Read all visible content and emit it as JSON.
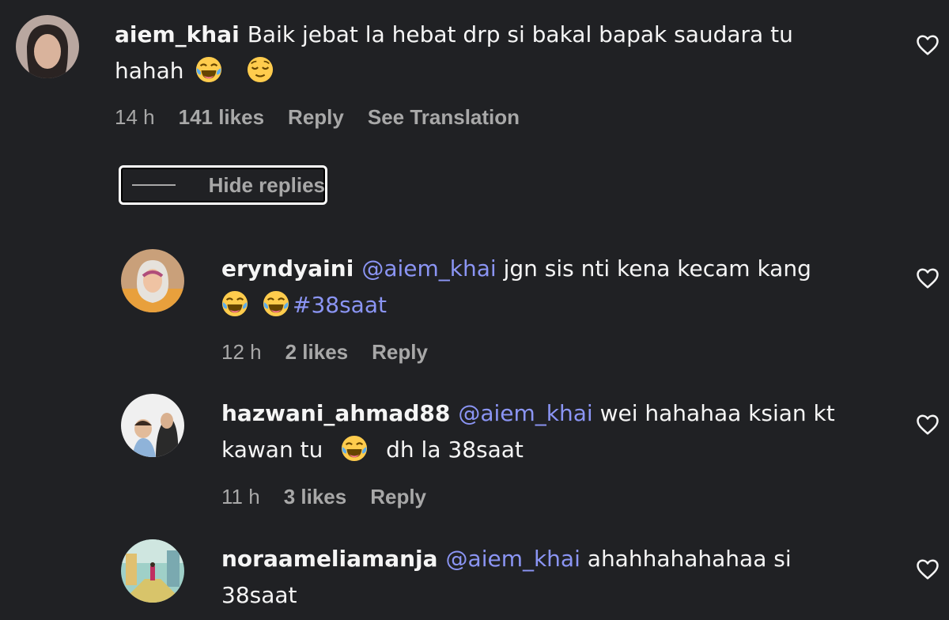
{
  "comments": [
    {
      "username": "aiem_khai",
      "text1": "Baik jebat la hebat drp si bakal bapak saudara tu",
      "text2": "hahah",
      "time": "14 h",
      "likes": "141 likes",
      "reply": "Reply",
      "translate": "See Translation"
    }
  ],
  "hide_replies_label": "Hide replies",
  "replies": [
    {
      "username": "eryndyaini",
      "mention": "@aiem_khai",
      "text1": "jgn sis nti kena kecam kang",
      "hashtag": "#38saat",
      "time": "12 h",
      "likes": "2 likes",
      "reply": "Reply"
    },
    {
      "username": "hazwani_ahmad88",
      "mention": "@aiem_khai",
      "text1": "wei hahahaa ksian kt",
      "text2a": "kawan tu",
      "text2b": "dh la 38saat",
      "time": "11 h",
      "likes": "3 likes",
      "reply": "Reply"
    },
    {
      "username": "noraameliamanja",
      "mention": "@aiem_khai",
      "text1": "ahahhahahahaa si",
      "text2": "38saat"
    }
  ],
  "colors": {
    "background": "#202124",
    "text": "#f5f5f5",
    "muted": "#a8a8a8",
    "mention": "#8b95f4"
  },
  "icons": [
    "heart-icon",
    "laughing-emoji",
    "relieved-emoji",
    "avatar"
  ]
}
